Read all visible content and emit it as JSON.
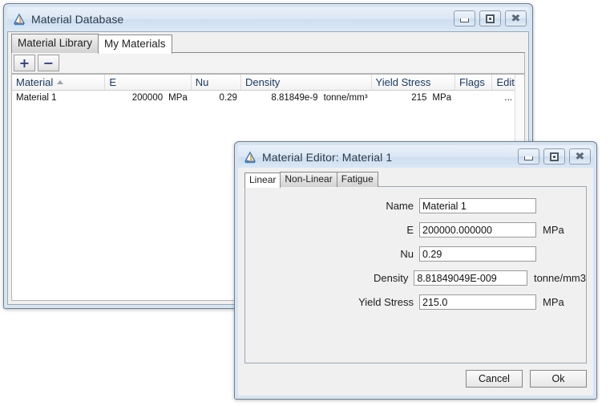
{
  "main_window": {
    "title": "Material Database",
    "icon": "app-triangle-icon",
    "controls": {
      "minimize": "minimize",
      "maximize": "maximize",
      "close": "close"
    },
    "tabs": [
      {
        "label": "Material Library",
        "active": false
      },
      {
        "label": "My Materials",
        "active": true
      }
    ],
    "toolbar": [
      {
        "label": "+",
        "name": "add-material-button"
      },
      {
        "label": "−",
        "name": "remove-material-button"
      }
    ],
    "grid": {
      "columns": [
        {
          "label": "Material",
          "sorted": "asc"
        },
        {
          "label": "E",
          "sorted": ""
        },
        {
          "label": "Nu",
          "sorted": ""
        },
        {
          "label": "Density",
          "sorted": ""
        },
        {
          "label": "Yield Stress",
          "sorted": ""
        },
        {
          "label": "Flags",
          "sorted": ""
        },
        {
          "label": "Edit",
          "sorted": ""
        }
      ],
      "rows": [
        {
          "material": "Material 1",
          "e_value": "200000",
          "e_unit": "MPa",
          "nu": "0.29",
          "density_value": "8.81849e-9",
          "density_unit": "tonne/mm³",
          "yield_value": "215",
          "yield_unit": "MPa",
          "flags": "",
          "edit": "..."
        }
      ]
    }
  },
  "editor_window": {
    "title": "Material Editor: Material 1",
    "icon": "app-triangle-icon",
    "controls": {
      "minimize": "minimize",
      "maximize": "maximize",
      "close": "close"
    },
    "tabs": [
      {
        "label": "Linear",
        "active": true
      },
      {
        "label": "Non-Linear",
        "active": false
      },
      {
        "label": "Fatigue",
        "active": false
      }
    ],
    "fields": [
      {
        "label": "Name",
        "value": "Material 1",
        "unit": ""
      },
      {
        "label": "E",
        "value": "200000.000000",
        "unit": "MPa"
      },
      {
        "label": "Nu",
        "value": "0.29",
        "unit": ""
      },
      {
        "label": "Density",
        "value": "8.81849049E-009",
        "unit": "tonne/mm3"
      },
      {
        "label": "Yield Stress",
        "value": "215.0",
        "unit": "MPa"
      }
    ],
    "buttons": [
      {
        "label": "Cancel",
        "name": "cancel-button"
      },
      {
        "label": "Ok",
        "name": "ok-button"
      }
    ]
  },
  "colors": {
    "window_frame": "#d7e4f2",
    "client_bg": "#f0f0f0",
    "grid_header_text": "#1b3a63",
    "toolbar_glyph": "#2e3b86"
  }
}
